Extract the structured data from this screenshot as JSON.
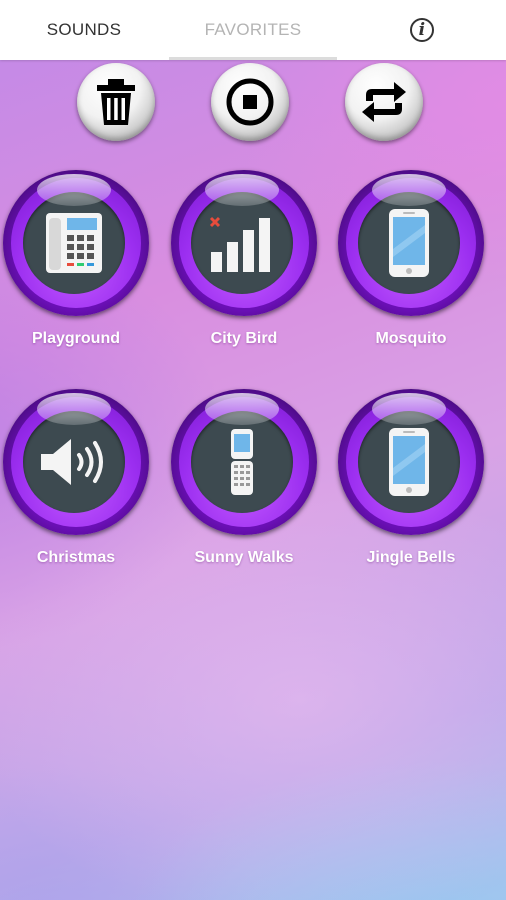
{
  "tabs": {
    "sounds": "SOUNDS",
    "favorites": "FAVORITES"
  },
  "controls": {
    "delete_icon": "trash-icon",
    "stop_icon": "stop-icon",
    "repeat_icon": "repeat-icon"
  },
  "colors": {
    "orb_purple": "#9b2ef0",
    "orb_center": "#3d4a50",
    "tab_active_text": "#333333",
    "tab_inactive_text": "#b4b4b4"
  },
  "sounds": [
    {
      "label": "Playground",
      "icon": "desk-phone-icon"
    },
    {
      "label": "City Bird",
      "icon": "signal-bars-icon"
    },
    {
      "label": "Mosquito",
      "icon": "smartphone-icon"
    },
    {
      "label": "Christmas",
      "icon": "speaker-icon"
    },
    {
      "label": "Sunny Walks",
      "icon": "flip-phone-icon"
    },
    {
      "label": "Jingle Bells",
      "icon": "smartphone-icon"
    }
  ]
}
